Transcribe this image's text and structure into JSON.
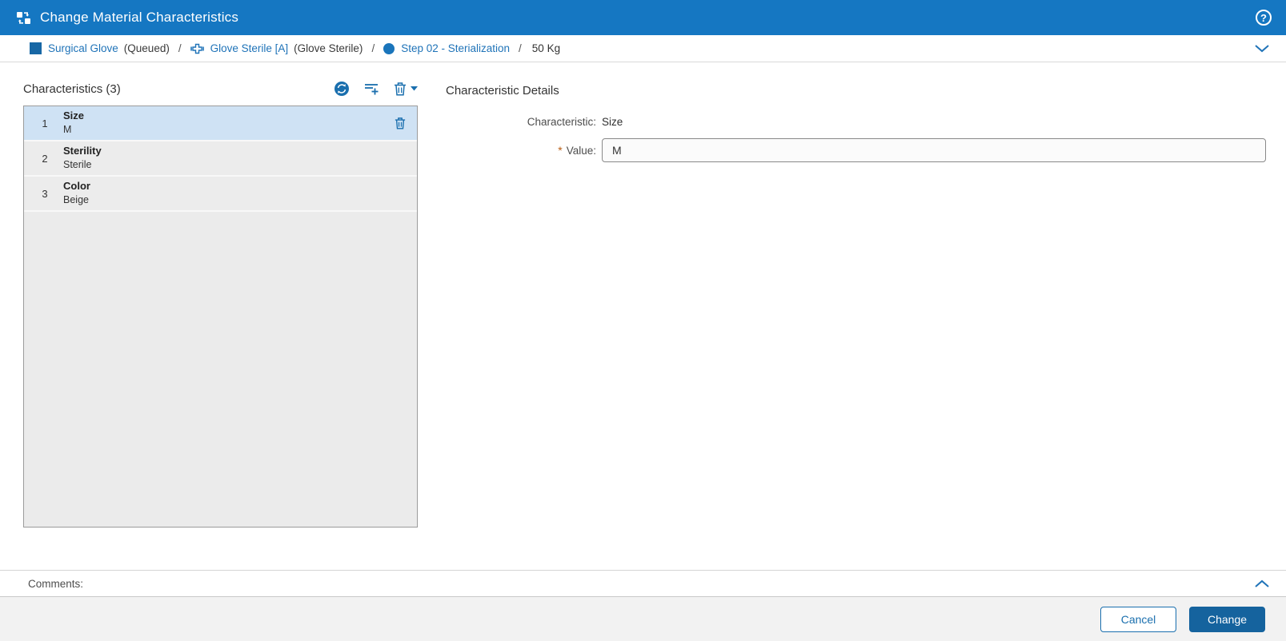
{
  "header": {
    "title": "Change Material Characteristics",
    "app_icon": "change-material-icon",
    "help_glyph": "?"
  },
  "breadcrumb": {
    "separator": "/",
    "segments": [
      {
        "icon": "material-square-icon",
        "title": "Surgical Glove",
        "status": "(Queued)"
      },
      {
        "icon": "order-icon",
        "title": "Glove Sterile [A]",
        "status": "(Glove Sterile)"
      },
      {
        "icon": "step-circle-icon",
        "title": "Step 02 - Sterialization",
        "status": ""
      }
    ],
    "quantity": "50 Kg"
  },
  "characteristics_panel": {
    "title": "Characteristics (3)",
    "toolbar": {
      "sync_icon": "sync-circle-icon",
      "add_icon": "add-row-icon",
      "delete_icon": "trash-icon",
      "delete_caret": "caret-down-icon"
    },
    "items": [
      {
        "index": "1",
        "name": "Size",
        "value": "M",
        "selected": true
      },
      {
        "index": "2",
        "name": "Sterility",
        "value": "Sterile",
        "selected": false
      },
      {
        "index": "3",
        "name": "Color",
        "value": "Beige",
        "selected": false
      }
    ]
  },
  "details_panel": {
    "title": "Characteristic Details",
    "fields": {
      "characteristic": {
        "label": "Characteristic:",
        "value": "Size"
      },
      "value": {
        "label": "Value:",
        "required_marker": "*",
        "input_value": "M"
      }
    }
  },
  "comments": {
    "label": "Comments:"
  },
  "footer": {
    "cancel": "Cancel",
    "change": "Change"
  },
  "colors": {
    "header_bg": "#1577c2",
    "link_blue": "#1f73b8",
    "icon_blue": "#1a6fae",
    "selected_row": "#cfe2f4",
    "primary_button": "#15639e",
    "required_marker": "#b95e16"
  }
}
